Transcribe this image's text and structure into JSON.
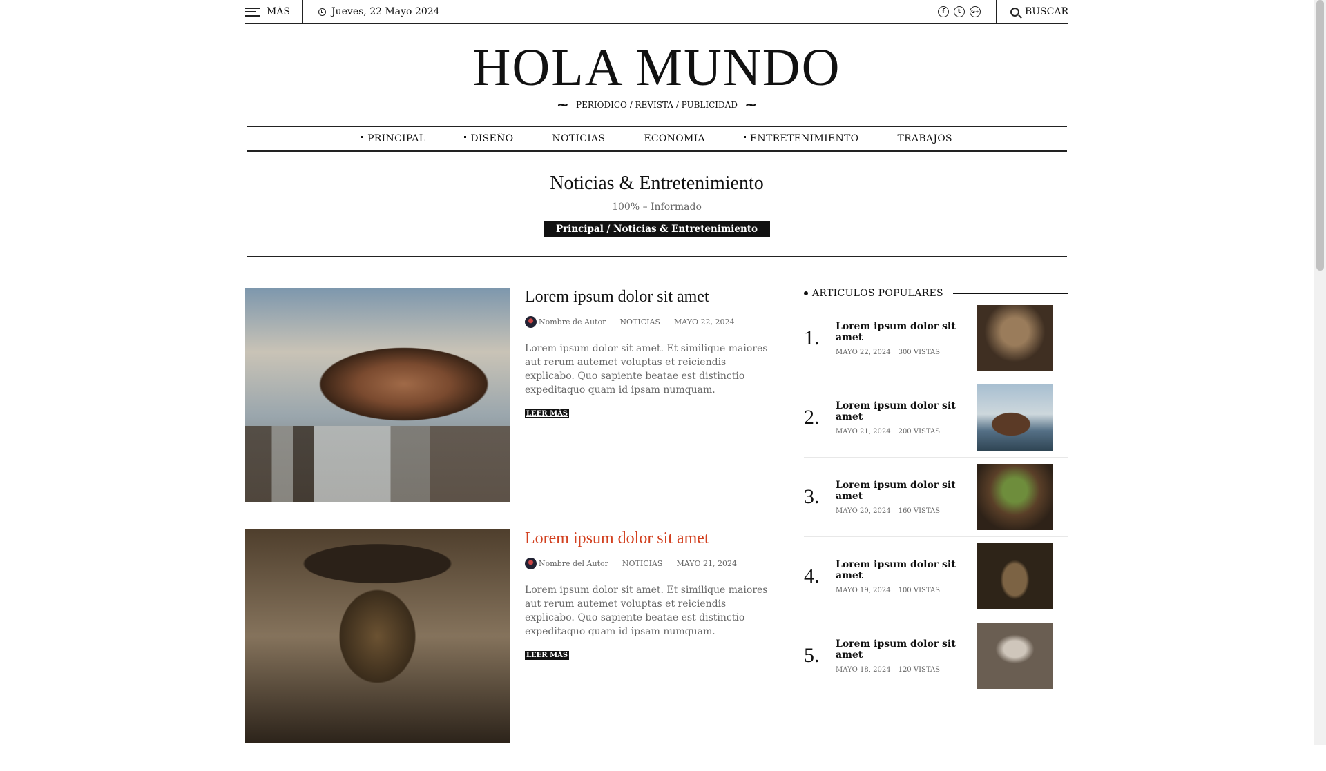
{
  "topbar": {
    "more_label": "MÁS",
    "date": "Jueves, 22 Mayo 2024",
    "social": [
      "f",
      "t",
      "G+"
    ],
    "search_label": "BUSCAR"
  },
  "masthead": {
    "logo": "HOLA MUNDO",
    "tagline": "PERIODICO / REVISTA / PUBLICIDAD"
  },
  "nav": {
    "items": [
      {
        "label": "PRINCIPAL",
        "has_submenu": true
      },
      {
        "label": "DISEÑO",
        "has_submenu": true
      },
      {
        "label": "NOTICIAS",
        "has_submenu": false
      },
      {
        "label": "ECONOMIA",
        "has_submenu": false
      },
      {
        "label": "ENTRETENIMIENTO",
        "has_submenu": true
      },
      {
        "label": "TRABAJOS",
        "has_submenu": false
      }
    ]
  },
  "section": {
    "title": "Noticias & Entretenimiento",
    "subtitle": "100% – Informado",
    "breadcrumb": "Principal / Noticias & Entretenimiento"
  },
  "posts": [
    {
      "title": "Lorem ipsum dolor sit amet",
      "author": "Nombre de Autor",
      "category": "NOTICIAS",
      "date": "MAYO 22, 2024",
      "excerpt": "Lorem ipsum dolor sit amet. Et similique maiores aut rerum autemet voluptas et reiciendis explicabo. Quo sapiente beatae est distinctio expeditaquo quam id ipsam numquam.",
      "read_more": "LEER MÁS",
      "image": "steampunk-airship"
    },
    {
      "title": "Lorem ipsum dolor sit amet",
      "author": "Nombre del Autor",
      "category": "NOTICIAS",
      "date": "MAYO 21, 2024",
      "excerpt": "Lorem ipsum dolor sit amet. Et similique maiores aut rerum autemet voluptas et reiciendis explicabo. Quo sapiente beatae est distinctio expeditaquo quam id ipsam numquam.",
      "read_more": "LEER MÁS",
      "image": "plague-doctor"
    }
  ],
  "sidebar": {
    "heading": "ARTICULOS POPULARES",
    "items": [
      {
        "num": "1.",
        "title": "Lorem ipsum dolor sit amet",
        "date": "MAYO 22, 2024",
        "views": "300 VISTAS"
      },
      {
        "num": "2.",
        "title": "Lorem ipsum dolor sit amet",
        "date": "MAYO 21, 2024",
        "views": "200 VISTAS"
      },
      {
        "num": "3.",
        "title": "Lorem ipsum dolor sit amet",
        "date": "MAYO 20, 2024",
        "views": "160 VISTAS"
      },
      {
        "num": "4.",
        "title": "Lorem ipsum dolor sit amet",
        "date": "MAYO 19, 2024",
        "views": "100 VISTAS"
      },
      {
        "num": "5.",
        "title": "Lorem ipsum dolor sit amet",
        "date": "MAYO 18, 2024",
        "views": "120 VISTAS"
      }
    ]
  },
  "colors": {
    "accent": "#d2401f",
    "text": "#111111",
    "muted": "#666666"
  }
}
